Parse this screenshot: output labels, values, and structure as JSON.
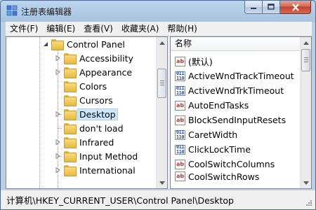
{
  "window": {
    "title": "注册表编辑器"
  },
  "menu": [
    "文件(F)",
    "编辑(E)",
    "查看(V)",
    "收藏夹(A)",
    "帮助(H)"
  ],
  "tree": {
    "parent": "Control Panel",
    "children": [
      {
        "label": "Accessibility",
        "expandable": true
      },
      {
        "label": "Appearance",
        "expandable": true
      },
      {
        "label": "Colors",
        "expandable": false
      },
      {
        "label": "Cursors",
        "expandable": false
      },
      {
        "label": "Desktop",
        "expandable": true,
        "selected": true
      },
      {
        "label": "don't load",
        "expandable": false
      },
      {
        "label": "Infrared",
        "expandable": true
      },
      {
        "label": "Input Method",
        "expandable": true
      },
      {
        "label": "International",
        "expandable": true
      }
    ]
  },
  "list": {
    "header": "名称",
    "rows": [
      {
        "name": "(默认)",
        "icon": "string-value-icon"
      },
      {
        "name": "ActiveWndTrackTimeout",
        "icon": "binary-value-icon"
      },
      {
        "name": "ActiveWndTrkTimeout",
        "icon": "binary-value-icon"
      },
      {
        "name": "AutoEndTasks",
        "icon": "string-value-icon"
      },
      {
        "name": "BlockSendInputResets",
        "icon": "string-value-icon"
      },
      {
        "name": "CaretWidth",
        "icon": "binary-value-icon"
      },
      {
        "name": "ClickLockTime",
        "icon": "binary-value-icon"
      },
      {
        "name": "CoolSwitchColumns",
        "icon": "string-value-icon"
      },
      {
        "name": "CoolSwitchRows",
        "icon": "string-value-icon"
      }
    ]
  },
  "status": {
    "path": "计算机\\HKEY_CURRENT_USER\\Control Panel\\Desktop"
  },
  "colors": {
    "selection": "#cce8ff",
    "titlebar": "#a9c3e0",
    "close_button": "#c2412e"
  }
}
